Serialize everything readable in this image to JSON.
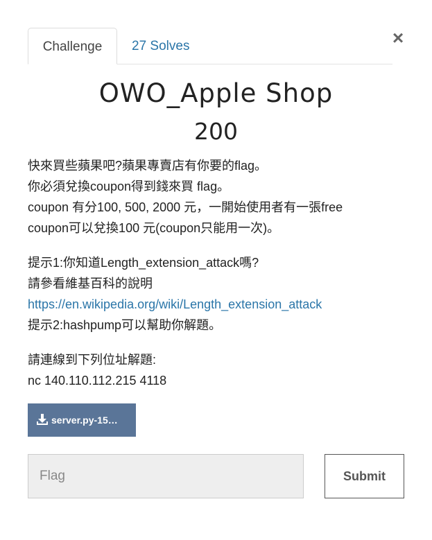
{
  "tabs": {
    "challenge_label": "Challenge",
    "solves_label": "27 Solves"
  },
  "close_label": "×",
  "challenge": {
    "name": "OWO_Apple Shop",
    "points": "200"
  },
  "description": {
    "paragraph1": [
      "快來買些蘋果吧?蘋果專賣店有你要的flag。",
      "你必須兌換coupon得到錢來買 flag。",
      "coupon 有分100, 500, 2000 元，一開始使用者有一張free",
      "coupon可以兌換100 元(coupon只能用一次)。"
    ],
    "paragraph2": {
      "hint1": "提示1:你知道Length_extension_attack嗎?",
      "wiki_text": "請參看維基百科的說明",
      "link": "https://en.wikipedia.org/wiki/Length_extension_attack",
      "hint2": "提示2:hashpump可以幫助你解題。"
    },
    "paragraph3": {
      "connect_text": "請連線到下列位址解題:",
      "command": "nc 140.110.112.215 4118"
    }
  },
  "file": {
    "label": "server.py-15…",
    "icon": "download-icon"
  },
  "flag_form": {
    "placeholder": "Flag",
    "value": "",
    "submit_label": "Submit"
  },
  "colors": {
    "link": "#2a75a8",
    "download_button": "#5a7598",
    "input_background": "#eeeeee"
  }
}
